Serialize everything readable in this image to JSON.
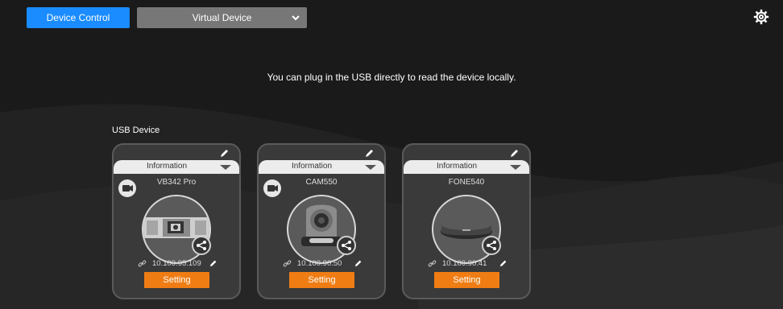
{
  "header": {
    "device_control_label": "Device Control",
    "device_type_selected": "Virtual Device"
  },
  "notice": "You can plug in the USB directly to read the device locally.",
  "usb_section_label": "USB Device",
  "colors": {
    "primary_button": "#1a8cff",
    "setting_button": "#ef7d14",
    "card_bg": "#3a3a3a",
    "page_bg": "#1b1b1b"
  },
  "devices": [
    {
      "info_label": "Information",
      "model": "VB342 Pro",
      "ip": "10.100.95.109",
      "setting_label": "Setting",
      "image_icon": "video-bar"
    },
    {
      "info_label": "Information",
      "model": "CAM550",
      "ip": "10.100.90.50",
      "setting_label": "Setting",
      "image_icon": "ptz-camera"
    },
    {
      "info_label": "Information",
      "model": "FONE540",
      "ip": "10.100.90.41",
      "setting_label": "Setting",
      "image_icon": "speakerphone"
    }
  ]
}
